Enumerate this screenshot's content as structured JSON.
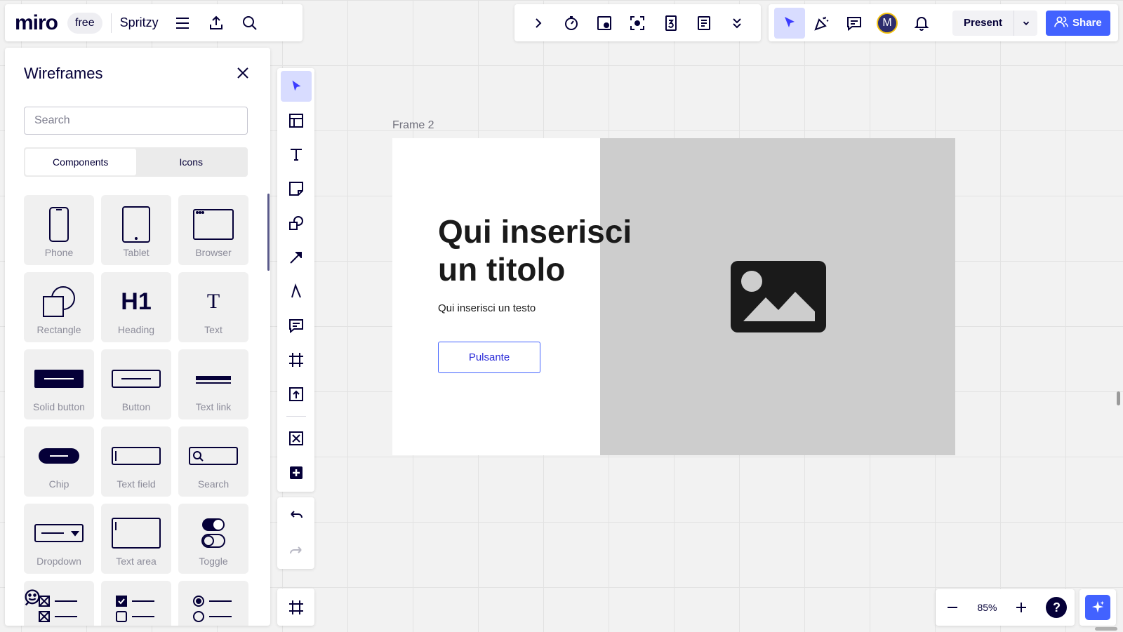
{
  "app": {
    "logo": "miro",
    "plan": "free",
    "board_name": "Spritzy"
  },
  "present": {
    "label": "Present"
  },
  "share": {
    "label": "Share"
  },
  "user": {
    "initial": "M"
  },
  "panel": {
    "title": "Wireframes",
    "search_placeholder": "Search",
    "tabs": [
      "Components",
      "Icons"
    ],
    "items": [
      "Phone",
      "Tablet",
      "Browser",
      "Rectangle",
      "Heading",
      "Text",
      "Solid button",
      "Button",
      "Text link",
      "Chip",
      "Text field",
      "Search",
      "Dropdown",
      "Text area",
      "Toggle"
    ],
    "heading_glyph": "H1",
    "text_glyph": "T"
  },
  "canvas": {
    "frame_label": "Frame 2",
    "title": "Qui inserisci un titolo",
    "body": "Qui inserisci un testo",
    "button": "Pulsante"
  },
  "zoom": {
    "value": "85%"
  },
  "help": "?"
}
